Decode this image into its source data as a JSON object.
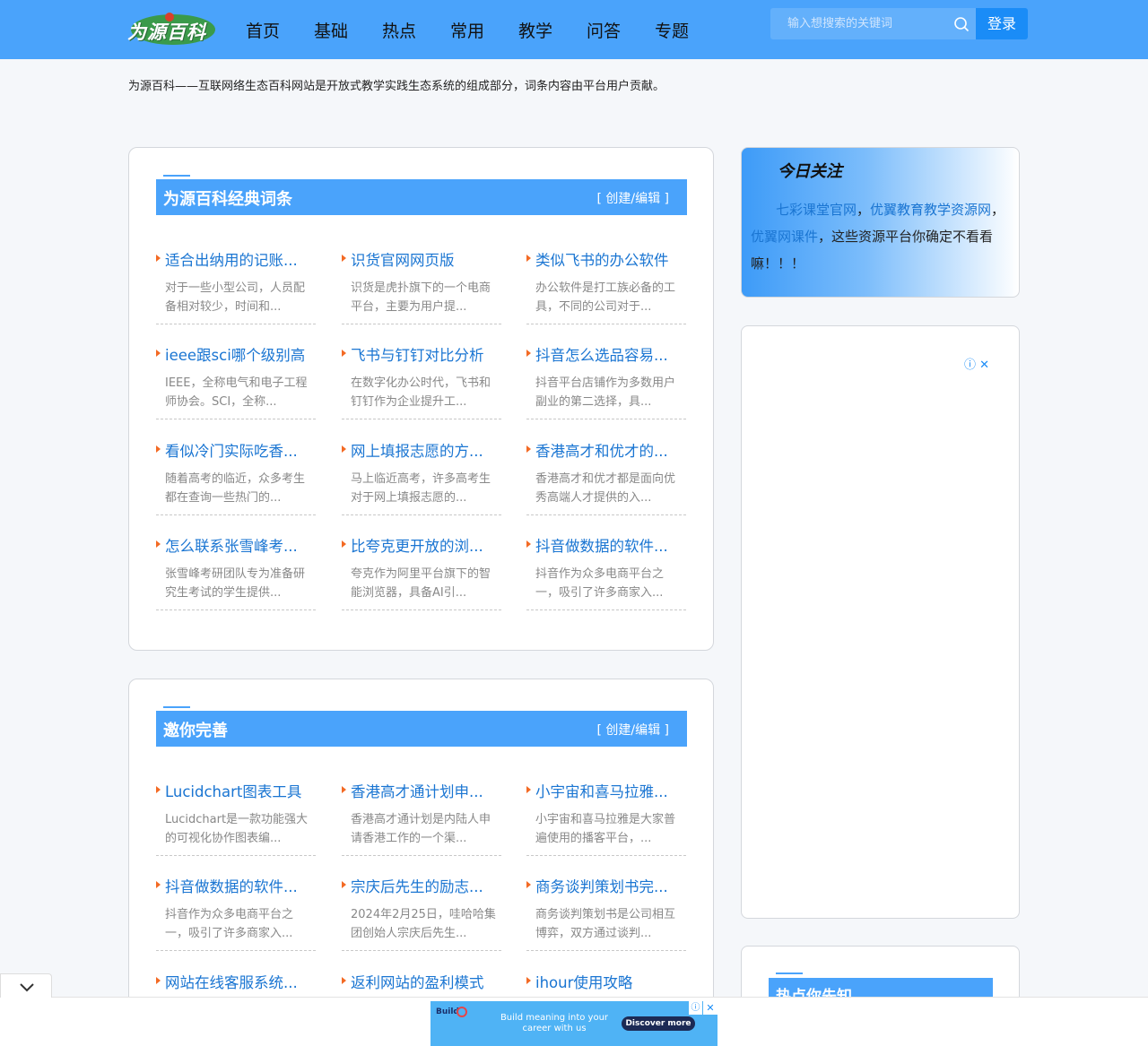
{
  "header": {
    "logo_text": "为源百科",
    "nav": [
      "首页",
      "基础",
      "热点",
      "常用",
      "教学",
      "问答",
      "专题"
    ],
    "search_placeholder": "输入想搜索的关键词",
    "login_label": "登录",
    "search_icon": "search-icon"
  },
  "notice": "为源百科——互联网络生态百科网站是开放式教学实践生态系统的组成部分，词条内容由平台用户贡献。",
  "sections": [
    {
      "title": "为源百科经典词条",
      "edit_label": "[ 创建/编辑 ]",
      "items": [
        {
          "title": "适合出纳用的记账...",
          "desc": "对于一些小型公司，人员配备相对较少，时间和..."
        },
        {
          "title": "识货官网网页版",
          "desc": "识货是虎扑旗下的一个电商平台，主要为用户提..."
        },
        {
          "title": "类似飞书的办公软件",
          "desc": "办公软件是打工族必备的工具，不同的公司对于..."
        },
        {
          "title": "ieee跟sci哪个级别高",
          "desc": "IEEE，全称电气和电子工程师协会。SCI，全称..."
        },
        {
          "title": "飞书与钉钉对比分析",
          "desc": "在数字化办公时代，飞书和钉钉作为企业提升工..."
        },
        {
          "title": "抖音怎么选品容易...",
          "desc": "抖音平台店铺作为多数用户副业的第二选择，具..."
        },
        {
          "title": "看似冷门实际吃香...",
          "desc": "随着高考的临近，众多考生都在查询一些热门的..."
        },
        {
          "title": "网上填报志愿的方...",
          "desc": "马上临近高考，许多高考生对于网上填报志愿的..."
        },
        {
          "title": "香港高才和优才的...",
          "desc": "香港高才和优才都是面向优秀高端人才提供的入..."
        },
        {
          "title": "怎么联系张雪峰考...",
          "desc": "张雪峰考研团队专为准备研究生考试的学生提供..."
        },
        {
          "title": "比夸克更开放的浏...",
          "desc": "夸克作为阿里平台旗下的智能浏览器，具备AI引..."
        },
        {
          "title": "抖音做数据的软件...",
          "desc": "抖音作为众多电商平台之一，吸引了许多商家入..."
        }
      ]
    },
    {
      "title": "邀你完善",
      "edit_label": "[ 创建/编辑 ]",
      "items": [
        {
          "title": "Lucidchart图表工具",
          "desc": "Lucidchart是一款功能强大的可视化协作图表编..."
        },
        {
          "title": "香港高才通计划申...",
          "desc": "香港高才通计划是内陆人申请香港工作的一个渠..."
        },
        {
          "title": "小宇宙和喜马拉雅...",
          "desc": "小宇宙和喜马拉雅是大家普遍使用的播客平台，..."
        },
        {
          "title": "抖音做数据的软件...",
          "desc": "抖音作为众多电商平台之一，吸引了许多商家入..."
        },
        {
          "title": "宗庆后先生的励志...",
          "desc": "2024年2月25日，哇哈哈集团创始人宗庆后先生..."
        },
        {
          "title": "商务谈判策划书完...",
          "desc": "商务谈判策划书是公司相互博弈，双方通过谈判..."
        },
        {
          "title": "网站在线客服系统...",
          "desc": ""
        },
        {
          "title": "返利网站的盈利模式",
          "desc": ""
        },
        {
          "title": "ihour使用攻略",
          "desc": ""
        }
      ]
    }
  ],
  "focus": {
    "heading": "今日关注",
    "link1": "七彩课堂官网",
    "sep1": "，",
    "link2": "优翼教育教学资源网",
    "sep2": "，",
    "link3": "优翼网课件",
    "rest": "，这些资源平台你确定不看看嘛！！！"
  },
  "hot_title": "热点你先知",
  "bottom_ad": {
    "brand": "Build",
    "message": "Build meaning into your career with us",
    "cta": "Discover more",
    "info_icon": "info-icon",
    "close_icon": "close-icon"
  },
  "colors": {
    "brand_blue": "#4aa3fb",
    "link_blue": "#1a75d2",
    "marker_orange": "#f36a24"
  }
}
